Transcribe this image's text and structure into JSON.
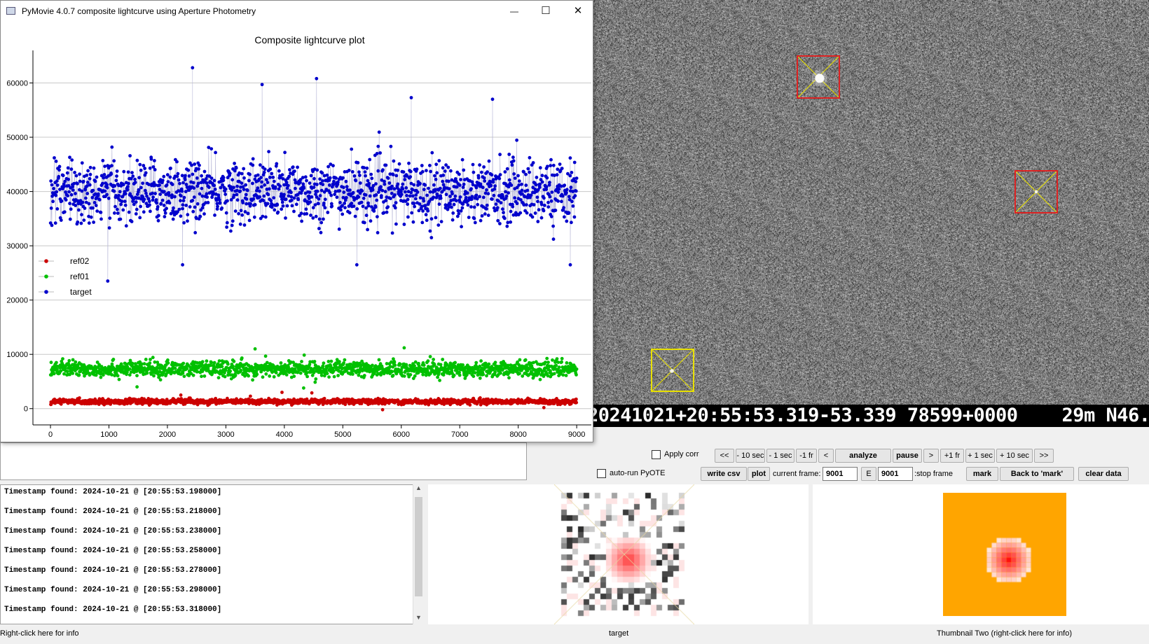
{
  "plot_window": {
    "title": "PyMovie 4.0.7 composite lightcurve using Aperture Photometry",
    "minimize_glyph": "—",
    "maximize_glyph": "☐",
    "close_glyph": "✕"
  },
  "chart_data": {
    "type": "scatter",
    "title": "Composite lightcurve plot",
    "xlabel": "",
    "ylabel": "",
    "xlim": [
      -300,
      9250
    ],
    "ylim": [
      -3000,
      66000
    ],
    "x_ticks": [
      0,
      1000,
      2000,
      3000,
      4000,
      5000,
      6000,
      7000,
      8000,
      9000
    ],
    "y_ticks": [
      0,
      10000,
      20000,
      30000,
      40000,
      50000,
      60000
    ],
    "grid": true,
    "legend_position": "left-middle",
    "x_range": [
      0,
      9001
    ],
    "series": [
      {
        "name": "ref02",
        "color": "#cc0000",
        "mean": 1300,
        "spread": 420,
        "outliers": [
          [
            3960,
            3000
          ],
          [
            4470,
            2900
          ],
          [
            5680,
            -200
          ],
          [
            2230,
            2500
          ]
        ]
      },
      {
        "name": "ref01",
        "color": "#00c000",
        "mean": 7300,
        "spread": 1300,
        "outliers": [
          [
            4330,
            3800
          ],
          [
            1480,
            4000
          ],
          [
            3500,
            11000
          ],
          [
            6050,
            11200
          ]
        ]
      },
      {
        "name": "target",
        "color": "#0000cc",
        "mean": 40000,
        "spread": 5200,
        "outliers": [
          [
            980,
            23500
          ],
          [
            2430,
            62800
          ],
          [
            4550,
            60800
          ],
          [
            3620,
            59700
          ],
          [
            7560,
            57000
          ],
          [
            6170,
            57300
          ],
          [
            5240,
            26500
          ],
          [
            8890,
            26500
          ],
          [
            2260,
            26500
          ]
        ]
      }
    ]
  },
  "image_view": {
    "timestamp_overlay": "20241021+20:55:53.319-53.339 78599+0000    29m N46."
  },
  "controls": {
    "apply_corr_label": "Apply corr",
    "auto_run_label": "auto-run PyOTE",
    "buttons_row1": [
      "<<",
      "- 10 sec",
      "- 1 sec",
      "-1 fr",
      "<",
      "analyze",
      "pause",
      ">",
      "+1 fr",
      "+ 1 sec",
      "+ 10 sec",
      ">>"
    ],
    "write_csv": "write csv",
    "plot": "plot",
    "current_frame_label": "current frame:",
    "current_frame_value": "9001",
    "e_button": "E",
    "stop_frame_value": "9001",
    "stop_frame_label": ":stop frame",
    "mark": "mark",
    "back_to_mark": "Back to 'mark'",
    "clear_data": "clear data"
  },
  "log": {
    "lines": [
      "Timestamp found: 2024-10-21 @ [20:55:53.198000]",
      "Timestamp found: 2024-10-21 @ [20:55:53.218000]",
      "Timestamp found: 2024-10-21 @ [20:55:53.238000]",
      "Timestamp found: 2024-10-21 @ [20:55:53.258000]",
      "Timestamp found: 2024-10-21 @ [20:55:53.278000]",
      "Timestamp found: 2024-10-21 @ [20:55:53.298000]",
      "Timestamp found: 2024-10-21 @ [20:55:53.318000]"
    ],
    "scroll_up": "▲",
    "scroll_down": "▼"
  },
  "captions": {
    "left": "Right-click here for info",
    "thumb1": "target",
    "thumb2": "Thumbnail Two (right-click here for info)"
  },
  "colors": {
    "thumb2_background": "#ffa500",
    "aperture_red": "#dd2222",
    "aperture_yellow": "#e8e000"
  }
}
